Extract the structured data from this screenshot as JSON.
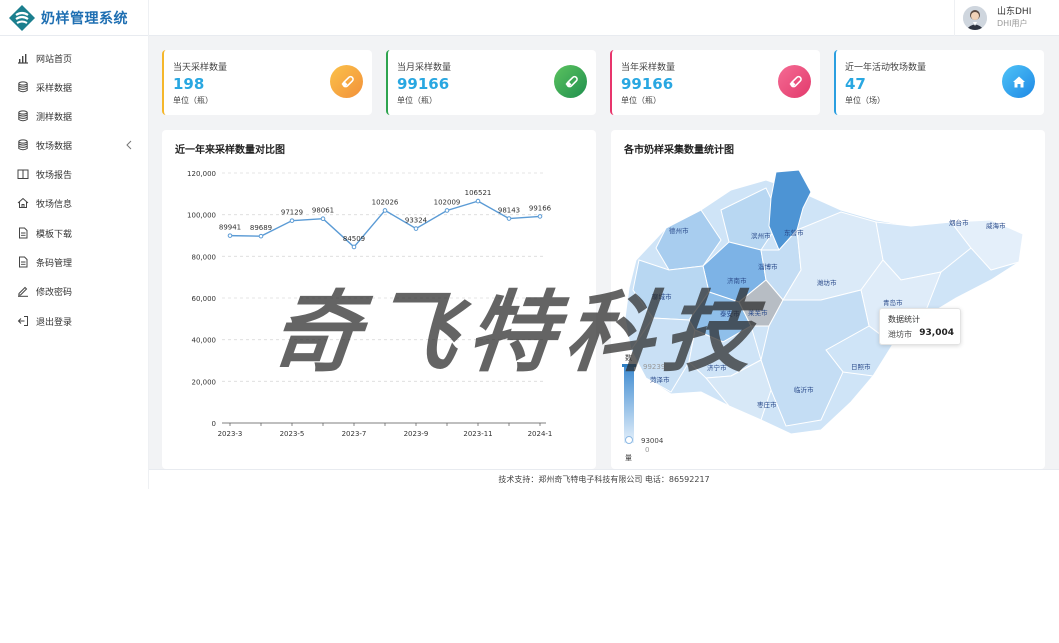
{
  "app": {
    "title": "奶样管理系统"
  },
  "user": {
    "name": "山东DHI",
    "role": "DHI用户"
  },
  "sidebar": {
    "items": [
      {
        "label": "网站首页",
        "icon": "bar-chart-icon"
      },
      {
        "label": "采样数据",
        "icon": "database-icon"
      },
      {
        "label": "测样数据",
        "icon": "database-icon"
      },
      {
        "label": "牧场数据",
        "icon": "database-icon"
      },
      {
        "label": "牧场报告",
        "icon": "book-icon"
      },
      {
        "label": "牧场信息",
        "icon": "home-icon"
      },
      {
        "label": "模板下载",
        "icon": "document-icon"
      },
      {
        "label": "条码管理",
        "icon": "document-icon"
      },
      {
        "label": "修改密码",
        "icon": "edit-icon"
      },
      {
        "label": "退出登录",
        "icon": "logout-icon"
      }
    ]
  },
  "stats": [
    {
      "title": "当天采样数量",
      "value": "198",
      "unit": "单位（瓶）",
      "color": "#f5b72b",
      "icon": "sample-tube-icon"
    },
    {
      "title": "当月采样数量",
      "value": "99166",
      "unit": "单位（瓶）",
      "color": "#2ea44f",
      "icon": "sample-tube-icon"
    },
    {
      "title": "当年采样数量",
      "value": "99166",
      "unit": "单位（瓶）",
      "color": "#e8356c",
      "icon": "sample-tube-icon"
    },
    {
      "title": "近一年活动牧场数量",
      "value": "47",
      "unit": "单位（场）",
      "color": "#2b9fe0",
      "icon": "home-icon"
    }
  ],
  "line_panel": {
    "title": "近一年来采样数量对比图"
  },
  "map_panel": {
    "title": "各市奶样采集数量统计图",
    "cities": [
      "德州市",
      "滨州市",
      "东营市",
      "烟台市",
      "威海市",
      "济南市",
      "淄博市",
      "聊城市",
      "泰安市",
      "莱芜市",
      "潍坊市",
      "青岛市",
      "日照市",
      "临沂市",
      "菏泽市",
      "济宁市",
      "枣庄市"
    ],
    "visual_map": {
      "label_top": "数",
      "label_bottom": "量",
      "max": "99239",
      "min_label": "93004",
      "min": "0"
    },
    "tooltip": {
      "title": "数据统计",
      "city": "潍坊市",
      "value": "93,004"
    }
  },
  "chart_data": {
    "type": "line",
    "title": "近一年来采样数量对比图",
    "x": [
      "2023-3",
      "2023-4",
      "2023-5",
      "2023-6",
      "2023-7",
      "2023-8",
      "2023-9",
      "2023-10",
      "2023-11",
      "2023-12",
      "2024-1"
    ],
    "x_tick_labels": [
      "2023-3",
      "2023-5",
      "2023-7",
      "2023-9",
      "2023-11",
      "2024-1"
    ],
    "values": [
      89941,
      89689,
      97129,
      98061,
      84509,
      102026,
      93324,
      102009,
      106521,
      98143,
      99166
    ],
    "ylim": [
      0,
      120000
    ],
    "y_ticks": [
      "0",
      "20,000",
      "40,000",
      "60,000",
      "80,000",
      "100,000",
      "120,000"
    ],
    "grid": true,
    "color": "#5b9bd5"
  },
  "footer": {
    "text": "技术支持：郑州奇飞特电子科技有限公司 电话：86592217"
  },
  "watermark": {
    "text": "奇飞特科技"
  }
}
